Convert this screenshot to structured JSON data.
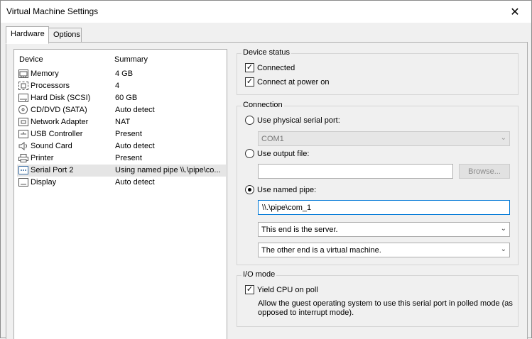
{
  "window": {
    "title": "Virtual Machine Settings",
    "close_glyph": "✕"
  },
  "tabs": [
    {
      "label": "Hardware"
    },
    {
      "label": "Options"
    }
  ],
  "device_list": {
    "headers": {
      "device": "Device",
      "summary": "Summary"
    },
    "rows": [
      {
        "device": "Memory",
        "summary": "4 GB",
        "icon": "memory-icon"
      },
      {
        "device": "Processors",
        "summary": "4",
        "icon": "processor-icon"
      },
      {
        "device": "Hard Disk (SCSI)",
        "summary": "60 GB",
        "icon": "hard-disk-icon"
      },
      {
        "device": "CD/DVD (SATA)",
        "summary": "Auto detect",
        "icon": "cd-dvd-icon"
      },
      {
        "device": "Network Adapter",
        "summary": "NAT",
        "icon": "network-adapter-icon"
      },
      {
        "device": "USB Controller",
        "summary": "Present",
        "icon": "usb-icon"
      },
      {
        "device": "Sound Card",
        "summary": "Auto detect",
        "icon": "speaker-icon"
      },
      {
        "device": "Printer",
        "summary": "Present",
        "icon": "printer-icon"
      },
      {
        "device": "Serial Port 2",
        "summary": "Using named pipe \\\\.\\pipe\\co...",
        "icon": "serial-port-icon",
        "selected": true
      },
      {
        "device": "Display",
        "summary": "Auto detect",
        "icon": "display-icon"
      }
    ]
  },
  "device_status": {
    "title": "Device status",
    "connected_label": "Connected",
    "connected_checked": true,
    "power_on_label": "Connect at power on",
    "power_on_checked": true
  },
  "connection": {
    "title": "Connection",
    "physical_label": "Use physical serial port:",
    "physical_selected": false,
    "physical_port_value": "COM1",
    "output_file_label": "Use output file:",
    "output_file_selected": false,
    "output_file_value": "",
    "browse_label": "Browse...",
    "named_pipe_label": "Use named pipe:",
    "named_pipe_selected": true,
    "named_pipe_value": "\\\\.\\pipe\\com_1",
    "this_end_value": "This end is the server.",
    "other_end_value": "The other end is a virtual machine."
  },
  "io_mode": {
    "title": "I/O mode",
    "yield_label": "Yield CPU on poll",
    "yield_checked": true,
    "description": "Allow the guest operating system to use this serial port in polled mode (as opposed to interrupt mode)."
  },
  "colors": {
    "selection": "#e5e5e5",
    "focus_border": "#0078d7",
    "panel": "#f0f0f0"
  }
}
